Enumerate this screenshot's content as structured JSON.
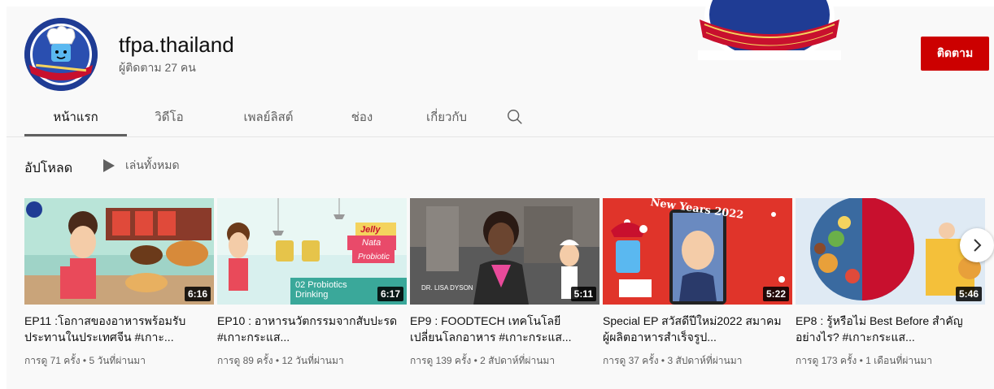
{
  "channel": {
    "name": "tfpa.thailand",
    "subscribers": "ผู้ติดตาม 27 คน",
    "subscribe_label": "ติดตาม"
  },
  "tabs": [
    {
      "label": "หน้าแรก",
      "active": true
    },
    {
      "label": "วิดีโอ",
      "active": false
    },
    {
      "label": "เพลย์ลิสต์",
      "active": false
    },
    {
      "label": "ช่อง",
      "active": false
    },
    {
      "label": "เกี่ยวกับ",
      "active": false
    }
  ],
  "search_icon": "search-icon",
  "shelf": {
    "title": "อัปโหลด",
    "play_all_label": "เล่นทั้งหมด"
  },
  "videos": [
    {
      "title": "EP11 :โอกาสของอาหารพร้อมรับประทานในประเทศจีน #เกาะ...",
      "duration": "6:16",
      "meta": "การดู 71 ครั้ง • 5 วันที่ผ่านมา"
    },
    {
      "title": "EP10 : อาหารนวัตกรรมจากสับปะรด #เกาะกระแส...",
      "duration": "6:17",
      "meta": "การดู 89 ครั้ง • 12 วันที่ผ่านมา",
      "thumb_text": "02 Probiotics Drinking",
      "jelly_text": "Jelly",
      "nata_text": "Nata",
      "probiotic_text": "Probiotic"
    },
    {
      "title": "EP9 : FOODTECH เทคโนโลยีเปลี่ยนโลกอาหาร #เกาะกระแส...",
      "duration": "5:11",
      "meta": "การดู 139 ครั้ง • 2 สัปดาห์ที่ผ่านมา",
      "thumb_text": "DR. LISA DYSON"
    },
    {
      "title": "Special EP สวัสดีปีใหม่2022 สมาคมผู้ผลิตอาหารสำเร็จรูป...",
      "duration": "5:22",
      "meta": "การดู 37 ครั้ง • 3 สัปดาห์ที่ผ่านมา",
      "thumb_text": "New Years 2022"
    },
    {
      "title": "EP8 : รู้หรือไม่ Best Before สำคัญอย่างไร? #เกาะกระแส...",
      "duration": "5:46",
      "meta": "การดู 173 ครั้ง • 1 เดือนที่ผ่านมา"
    }
  ],
  "colors": {
    "subscribe": "#cc0000",
    "brand_blue": "#203a8e",
    "brand_red": "#c8102e"
  },
  "next_icon": "chevron-right-icon"
}
